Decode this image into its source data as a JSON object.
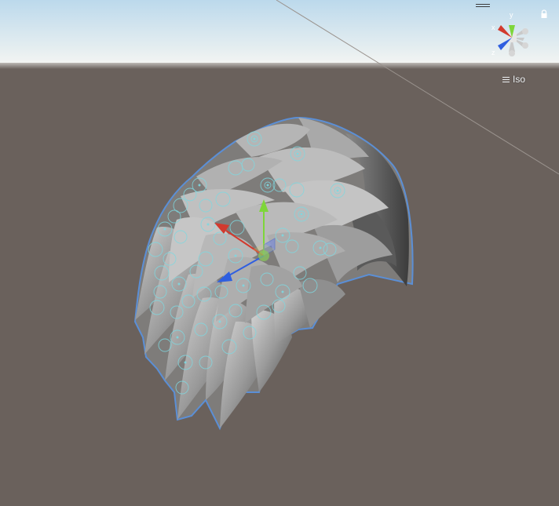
{
  "scene_view": {
    "projection_label": "Iso",
    "gizmo_axes": {
      "x": "x",
      "y": "y",
      "z": "z"
    },
    "colors": {
      "sky_top": "#cfe3f2",
      "horizon": "#dde9ee",
      "ground": "#6a615c",
      "mesh": "#9a9a9a",
      "mesh_shadow": "#4a4a4a",
      "selection_outline": "#5b8fd6",
      "bone_gizmo": "#7fd8e0",
      "axis_x": "#d23a2e",
      "axis_y": "#7ed63a",
      "axis_z": "#2f5fe0"
    }
  }
}
